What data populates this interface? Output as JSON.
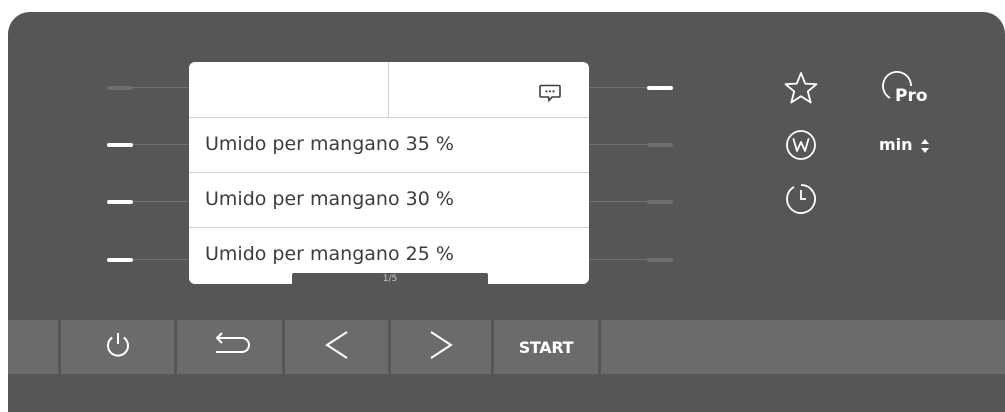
{
  "display": {
    "options": [
      {
        "label": "Umido per mangano 35 %"
      },
      {
        "label": "Umido per mangano 30 %"
      },
      {
        "label": "Umido per mangano 25 %"
      }
    ],
    "page_indicator": "1/5",
    "header_icon": "message-dots-icon"
  },
  "sensors": {
    "left": [
      false,
      true,
      true,
      true
    ],
    "right": [
      true,
      false,
      false,
      false
    ]
  },
  "side_controls": {
    "favourites_icon": "star-icon",
    "pro_label": "Pro",
    "pro_icon": "pro-programme-icon",
    "wrinkle_icon": "w-circle-icon",
    "time_label": "min",
    "time_adjust_icon": "up-down-arrows-icon",
    "delay_start_icon": "clock-icon"
  },
  "bottom_bar": {
    "power_icon": "power-icon",
    "back_icon": "back-arrow-icon",
    "prev_icon": "chevron-left-icon",
    "next_icon": "chevron-right-icon",
    "start_label": "START"
  },
  "colors": {
    "panel": "#555658",
    "button": "#6a6b6d",
    "screen": "#ffffff",
    "text": "#3d3d3f"
  }
}
